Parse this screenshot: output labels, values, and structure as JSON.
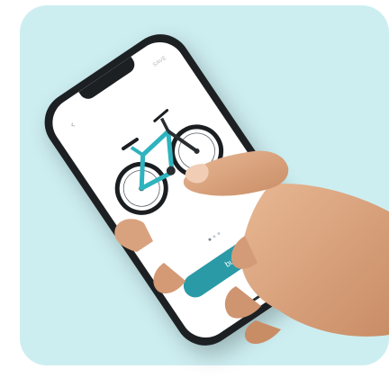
{
  "colors": {
    "backdrop": "#cdeef1",
    "phone_frame": "#1d2023",
    "screen": "#ffffff",
    "accent": "#2a9aa6",
    "bike_frame": "#2fb3be",
    "skin": "#d9a27e"
  },
  "app": {
    "back_icon": "chevron-left-icon",
    "top_right_label": "SAVE",
    "product_image": "mountain-bike",
    "carousel": {
      "pages": 3,
      "active_index": 0
    },
    "buy_label": "buy"
  }
}
